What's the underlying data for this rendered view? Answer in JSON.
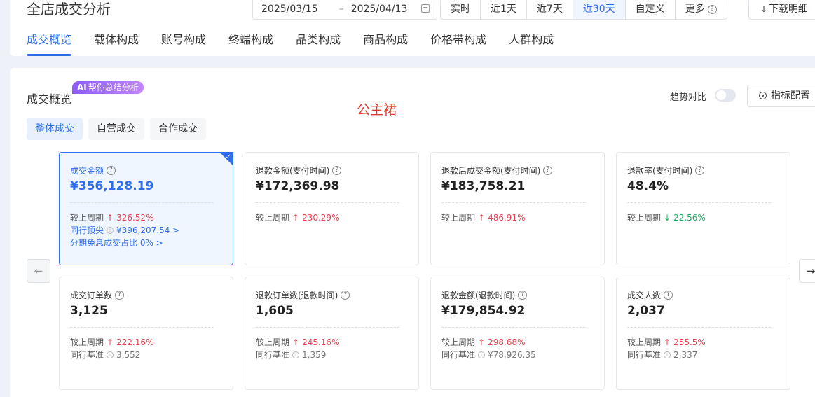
{
  "header": {
    "title": "全店成交分析",
    "date_start": "2025/03/15",
    "date_sep": "–",
    "date_end": "2025/04/13",
    "ranges": [
      "实时",
      "近1天",
      "近7天",
      "近30天",
      "自定义",
      "更多"
    ],
    "active_range": "近30天",
    "download_label": "下载明细",
    "tabs": [
      "成交概览",
      "载体构成",
      "账号构成",
      "终端构成",
      "品类构成",
      "商品构成",
      "价格带构成",
      "人群构成"
    ]
  },
  "panel": {
    "section_title": "成交概览",
    "ai_badge_ai": "AI",
    "ai_badge_text": "帮你总结分析",
    "product_label": "公主裙",
    "trend_label": "趋势对比",
    "config_label": "指标配置",
    "sub_tabs": [
      "整体成交",
      "自营成交",
      "合作成交"
    ]
  },
  "cards": [
    {
      "label": "成交金额",
      "value": "¥356,128.19",
      "cmp_label": "较上周期",
      "cmp_dir": "up",
      "cmp_value": "326.52%",
      "extra1_label": "同行顶尖",
      "extra1_value": "¥396,207.54 >",
      "extra2": "分期免息成交占比 0% >"
    },
    {
      "label": "退款金额(支付时间)",
      "value": "¥172,369.98",
      "cmp_label": "较上周期",
      "cmp_dir": "up",
      "cmp_value": "230.29%"
    },
    {
      "label": "退款后成交金额(支付时间)",
      "value": "¥183,758.21",
      "cmp_label": "较上周期",
      "cmp_dir": "up",
      "cmp_value": "486.91%"
    },
    {
      "label": "退款率(支付时间)",
      "value": "48.4%",
      "cmp_label": "较上周期",
      "cmp_dir": "down",
      "cmp_value": "22.56%"
    },
    {
      "label": "成交订单数",
      "value": "3,125",
      "cmp_label": "较上周期",
      "cmp_dir": "up",
      "cmp_value": "222.16%",
      "bench_label": "同行基准",
      "bench_value": "3,552"
    },
    {
      "label": "退款订单数(退款时间)",
      "value": "1,605",
      "cmp_label": "较上周期",
      "cmp_dir": "up",
      "cmp_value": "245.16%",
      "bench_label": "同行基准",
      "bench_value": "1,359"
    },
    {
      "label": "退款金额(退款时间)",
      "value": "¥179,854.92",
      "cmp_label": "较上周期",
      "cmp_dir": "up",
      "cmp_value": "298.68%",
      "bench_label": "同行基准",
      "bench_value": "¥78,926.35"
    },
    {
      "label": "成交人数",
      "value": "2,037",
      "cmp_label": "较上周期",
      "cmp_dir": "up",
      "cmp_value": "255.5%",
      "bench_label": "同行基准",
      "bench_value": "2,337"
    }
  ],
  "icons": {
    "up": "↑",
    "down": "↓",
    "prev": "←",
    "next": "→",
    "help": "?",
    "info": "i",
    "download": "↓",
    "check": "✓"
  },
  "colors": {
    "accent": "#2f6fed",
    "up": "#e5414f",
    "down": "#1fae62",
    "product_label": "#e03a2f"
  }
}
